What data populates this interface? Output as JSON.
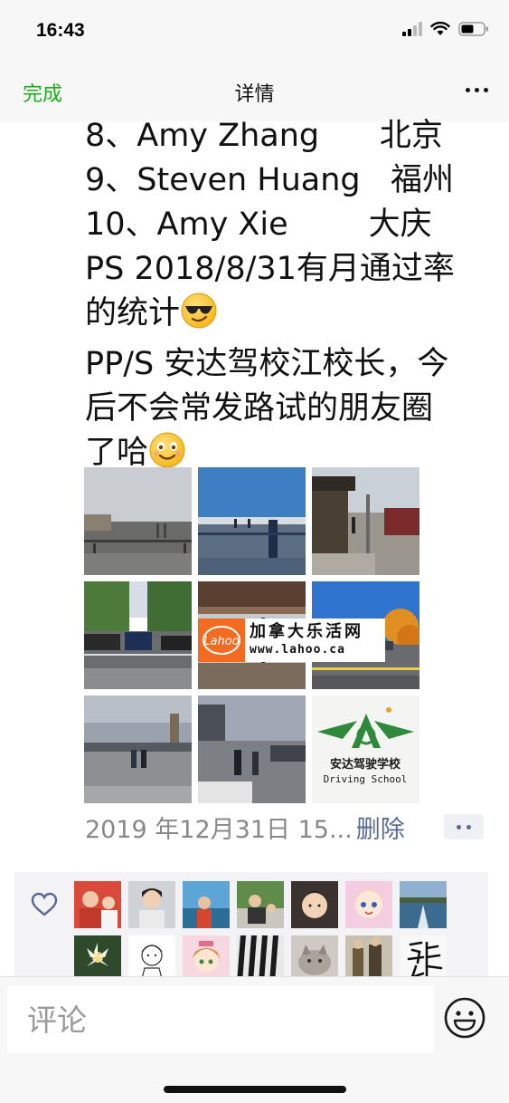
{
  "status_bar": {
    "time": "16:43",
    "icons": [
      "cellular-signal-icon",
      "wifi-icon",
      "battery-icon"
    ]
  },
  "nav": {
    "done_label": "完成",
    "title": "详情",
    "more_icon": "more-dots-icon"
  },
  "post": {
    "lines": [
      "8、Amy Zhang      北京",
      "9、Steven Huang   福州",
      "10、Amy Xie        大庆",
      "PS 2018/8/31有月通过率",
      "的统计",
      "PP/S 安达驾校江校长，今",
      "后不会常发路试的朋友圈",
      "了哈"
    ],
    "emojis": [
      "sunglasses-emoji-icon",
      "smiling-emoji-icon"
    ],
    "photos": [
      "photo-parking-lot-cloudy",
      "photo-parking-lot-blue-sky",
      "photo-storefront-sidewalk",
      "photo-car-in-parking-space",
      "photo-store-awning",
      "photo-autumn-tree-parking",
      "photo-people-walking-lot",
      "photo-people-walking-street",
      "photo-driving-school-logo"
    ],
    "logo_text_cn": "安达驾驶学校",
    "logo_text_en": "Driving School"
  },
  "watermark": {
    "logo_text": "Lahoo",
    "cn_text": "加拿大乐活网",
    "url": "www.lahoo.ca"
  },
  "meta": {
    "timestamp": "2019 年12月31日 15...",
    "delete_label": "删除"
  },
  "likes": {
    "icon": "heart-icon",
    "avatar_count": 14
  },
  "comment": {
    "placeholder": "评论",
    "emoji_icon": "emoji-face-icon"
  },
  "colors": {
    "accent_green": "#1aad19",
    "link_blue": "#576b95",
    "watermark_orange": "#f26b21"
  }
}
